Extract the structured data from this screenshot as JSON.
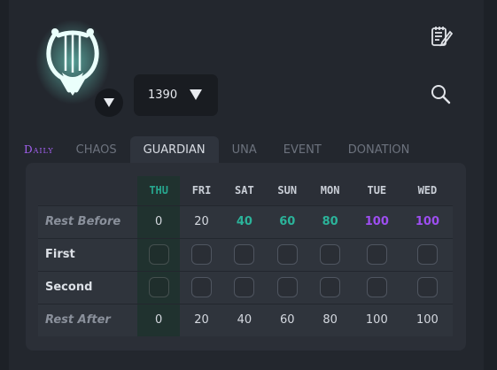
{
  "header": {
    "class_icon": "lyre-icon",
    "level_value": "1390",
    "notes_icon": "notes-edit-icon",
    "search_icon": "search-icon"
  },
  "tabs": [
    {
      "label": "Daily",
      "active": false
    },
    {
      "label": "CHAOS",
      "active": false
    },
    {
      "label": "GUARDIAN",
      "active": true
    },
    {
      "label": "UNA",
      "active": false
    },
    {
      "label": "EVENT",
      "active": false
    },
    {
      "label": "DONATION",
      "active": false
    }
  ],
  "table": {
    "columns": [
      "THU",
      "FRI",
      "SAT",
      "SUN",
      "MON",
      "TUE",
      "WED"
    ],
    "highlight_column": "THU",
    "rows": {
      "rest_before": {
        "label": "Rest Before",
        "values": [
          "0",
          "20",
          "40",
          "60",
          "80",
          "100",
          "100"
        ]
      },
      "first": {
        "label": "First"
      },
      "second": {
        "label": "Second"
      },
      "rest_after": {
        "label": "Rest After",
        "values": [
          "0",
          "20",
          "40",
          "60",
          "80",
          "100",
          "100"
        ]
      }
    }
  },
  "colors": {
    "accent_teal": "#2bb39a",
    "accent_purple": "#9d4ef0",
    "background": "#23272e"
  }
}
